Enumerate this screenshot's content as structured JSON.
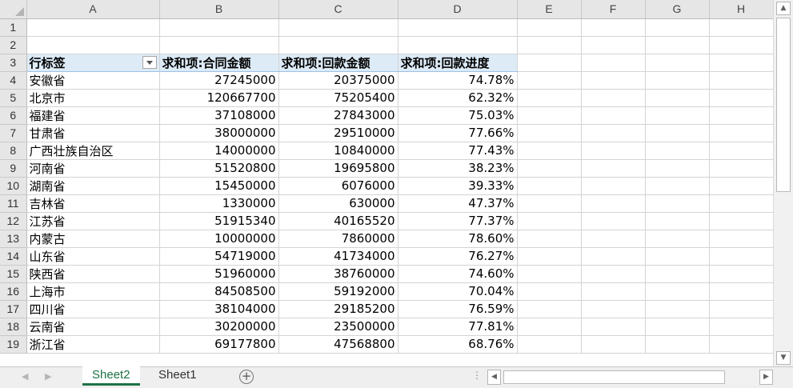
{
  "columns": [
    "A",
    "B",
    "C",
    "D",
    "E",
    "F",
    "G",
    "H"
  ],
  "rows": [
    "1",
    "2",
    "3",
    "4",
    "5",
    "6",
    "7",
    "8",
    "9",
    "10",
    "11",
    "12",
    "13",
    "14",
    "15",
    "16",
    "17",
    "18",
    "19"
  ],
  "pivot": {
    "headers": [
      "行标签",
      "求和项:合同金额",
      "求和项:回款金额",
      "求和项:回款进度"
    ],
    "data": [
      [
        "安徽省",
        "27245000",
        "20375000",
        "74.78%"
      ],
      [
        "北京市",
        "120667700",
        "75205400",
        "62.32%"
      ],
      [
        "福建省",
        "37108000",
        "27843000",
        "75.03%"
      ],
      [
        "甘肃省",
        "38000000",
        "29510000",
        "77.66%"
      ],
      [
        "广西壮族自治区",
        "14000000",
        "10840000",
        "77.43%"
      ],
      [
        "河南省",
        "51520800",
        "19695800",
        "38.23%"
      ],
      [
        "湖南省",
        "15450000",
        "6076000",
        "39.33%"
      ],
      [
        "吉林省",
        "1330000",
        "630000",
        "47.37%"
      ],
      [
        "江苏省",
        "51915340",
        "40165520",
        "77.37%"
      ],
      [
        "内蒙古",
        "10000000",
        "7860000",
        "78.60%"
      ],
      [
        "山东省",
        "54719000",
        "41734000",
        "76.27%"
      ],
      [
        "陕西省",
        "51960000",
        "38760000",
        "74.60%"
      ],
      [
        "上海市",
        "84508500",
        "59192000",
        "70.04%"
      ],
      [
        "四川省",
        "38104000",
        "29185200",
        "76.59%"
      ],
      [
        "云南省",
        "30200000",
        "23500000",
        "77.81%"
      ],
      [
        "浙江省",
        "69177800",
        "47568800",
        "68.76%"
      ]
    ]
  },
  "sheet_tabs": [
    {
      "label": "Sheet2",
      "active": true
    },
    {
      "label": "Sheet1",
      "active": false
    }
  ],
  "add_sheet_symbol": "+",
  "colors": {
    "pivot_header_bg": "#ddebf7",
    "active_tab": "#1e7145",
    "header_bg": "#e6e6e6"
  },
  "icons": [
    "corner-select-all-icon",
    "filter-dropdown-icon",
    "scroll-up-icon",
    "scroll-down-icon",
    "scroll-left-icon",
    "scroll-right-icon",
    "sheet-nav-prev-icon",
    "sheet-nav-next-icon",
    "add-sheet-icon"
  ]
}
